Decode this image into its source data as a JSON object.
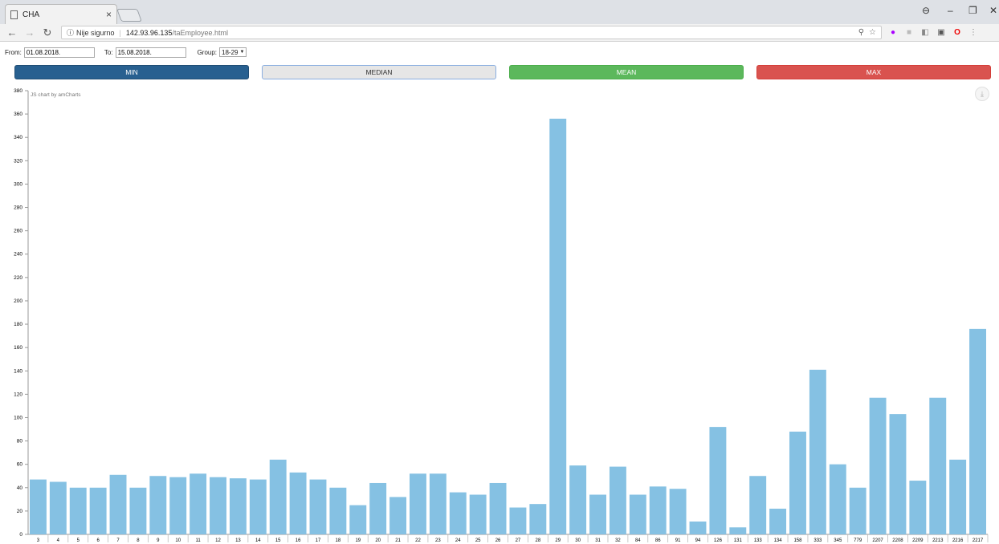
{
  "browser": {
    "tab_title": "CHA",
    "tab_close": "×",
    "url_security": "Nije sigurno",
    "url_host": "142.93.96.135",
    "url_path": "/taEmployee.html",
    "win_controls": [
      "⊖",
      "–",
      "❐",
      "✕"
    ]
  },
  "filters": {
    "from_label": "From:",
    "from_value": "01.08.2018.",
    "to_label": "To:",
    "to_value": "15.08.2018.",
    "group_label": "Group:",
    "group_value": "18-29"
  },
  "stat_buttons": {
    "min": "MIN",
    "median": "MEDIAN",
    "mean": "MEAN",
    "max": "MAX"
  },
  "colors": {
    "bar": "#85c1e3",
    "min": "#286090",
    "mean": "#5cb85c",
    "max": "#d9534f"
  },
  "chart_credit": "JS chart by amCharts",
  "chart_data": {
    "type": "bar",
    "categories": [
      "3",
      "4",
      "5",
      "6",
      "7",
      "8",
      "9",
      "10",
      "11",
      "12",
      "13",
      "14",
      "15",
      "16",
      "17",
      "18",
      "19",
      "20",
      "21",
      "22",
      "23",
      "24",
      "25",
      "26",
      "27",
      "28",
      "29",
      "30",
      "31",
      "32",
      "84",
      "86",
      "91",
      "94",
      "126",
      "131",
      "133",
      "134",
      "158",
      "333",
      "345",
      "779",
      "2207",
      "2208",
      "2209",
      "2213",
      "2216",
      "2217"
    ],
    "values": [
      47,
      45,
      40,
      40,
      51,
      40,
      50,
      49,
      52,
      49,
      48,
      47,
      64,
      53,
      47,
      40,
      25,
      44,
      32,
      52,
      52,
      36,
      34,
      44,
      23,
      26,
      356,
      59,
      34,
      58,
      34,
      41,
      39,
      11,
      92,
      6,
      50,
      22,
      88,
      141,
      60,
      40,
      117,
      103,
      46,
      117,
      64,
      176
    ],
    "ylim": [
      0,
      380
    ],
    "yticks": [
      0,
      20,
      40,
      60,
      80,
      100,
      120,
      140,
      160,
      180,
      200,
      220,
      240,
      260,
      280,
      300,
      320,
      340,
      360,
      380
    ],
    "grid": false
  }
}
